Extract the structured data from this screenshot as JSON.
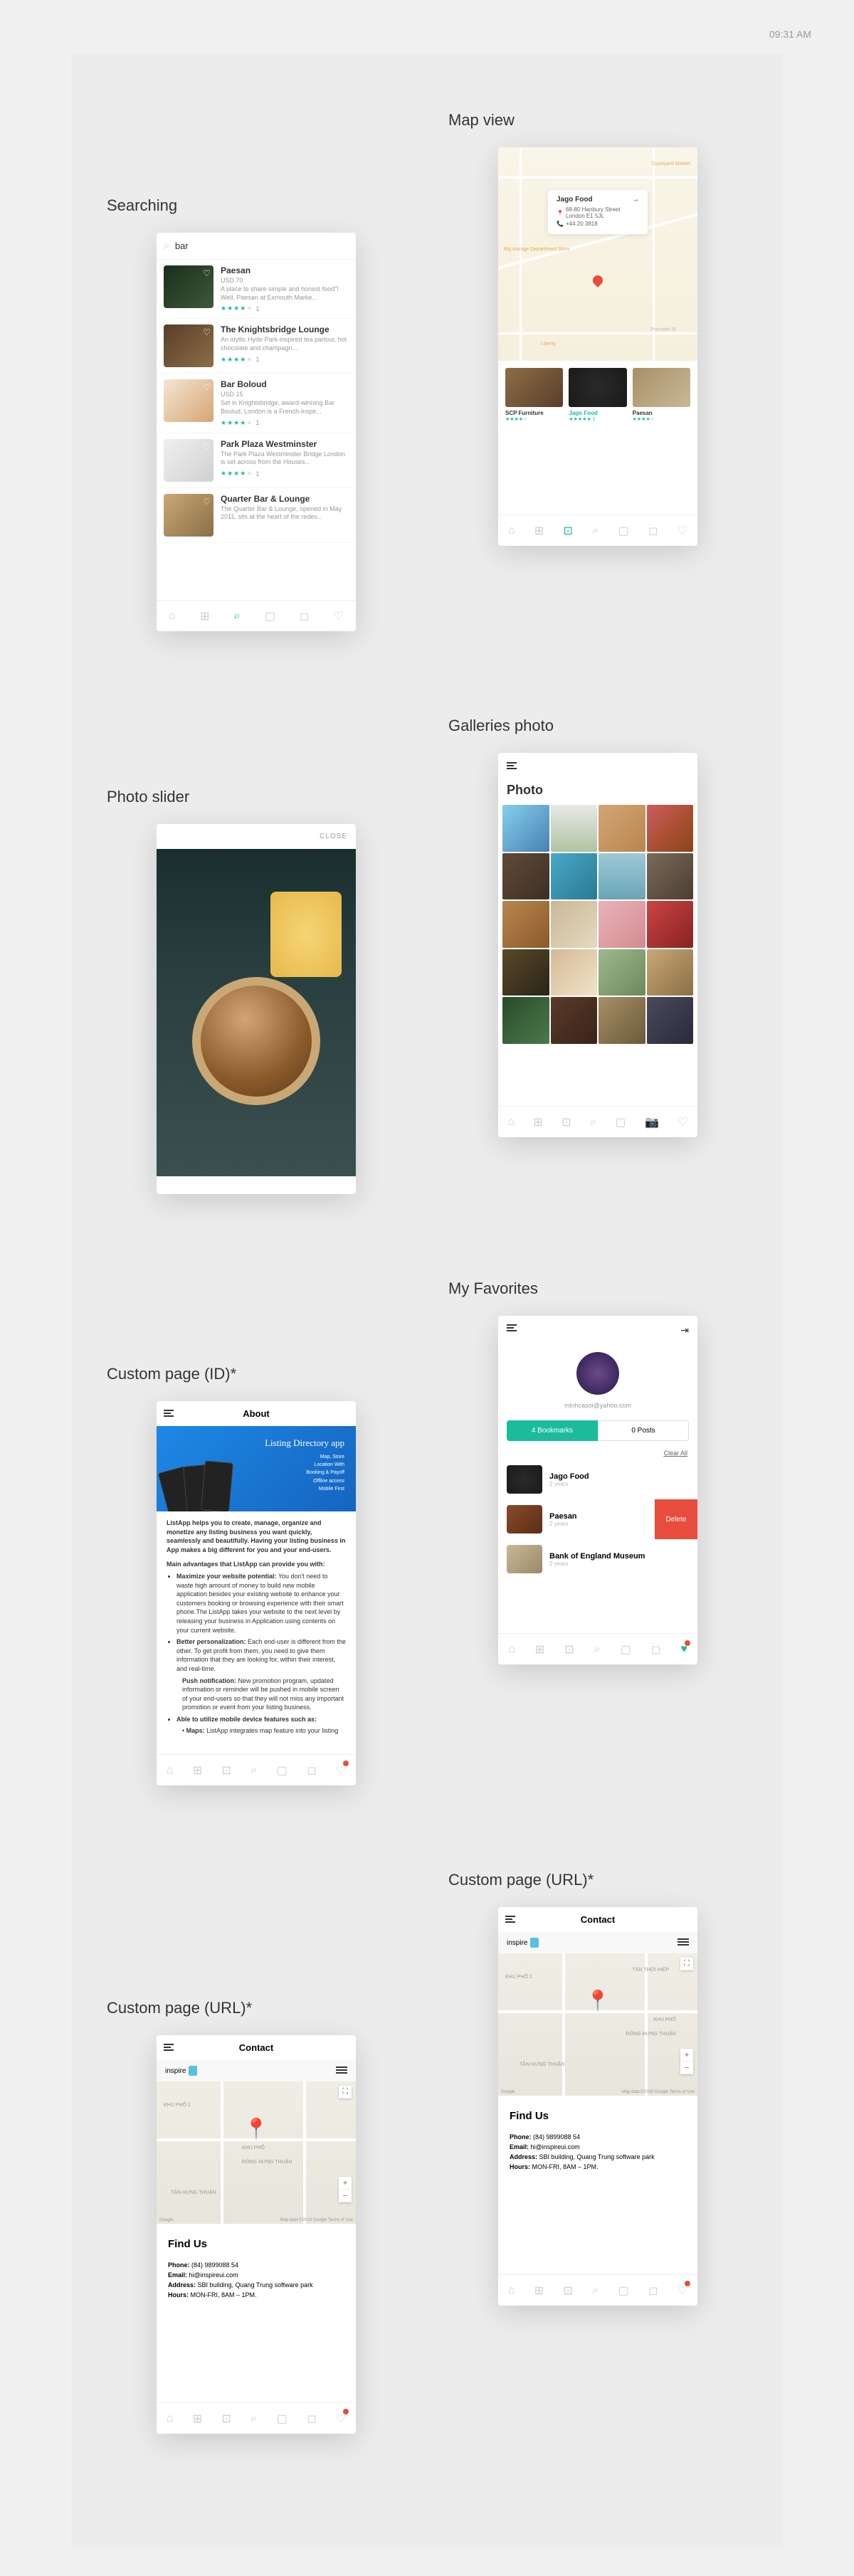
{
  "time": "09:31 AM",
  "sections": {
    "searching": "Searching",
    "mapview": "Map view",
    "galleries": "Galleries photo",
    "slider": "Photo slider",
    "favorites": "My Favorites",
    "customId": "Custom page (ID)*",
    "customUrl": "Custom page (URL)*"
  },
  "search": {
    "query": "bar",
    "results": [
      {
        "title": "Paesan",
        "price": "USD 70",
        "desc": "A place to share simple and honest food\"! Well, Paesan at Exmouth Marke...",
        "stars": 4,
        "reviews": 1
      },
      {
        "title": "The Knightsbridge Lounge",
        "price": "",
        "desc": "An idyllic Hyde Park-inspired tea parlour, hot chocolate and champagn...",
        "stars": 4,
        "reviews": 1
      },
      {
        "title": "Bar Boloud",
        "price": "USD 15",
        "desc": "Set in Knightsbridge, award-winning Bar Boulud, London is a French-inspir...",
        "stars": 4,
        "reviews": 1
      },
      {
        "title": "Park Plaza Westminster",
        "price": "",
        "desc": "The Park Plaza Westminster Bridge London is set across from the Houses...",
        "stars": 4,
        "reviews": 1
      },
      {
        "title": "Quarter Bar & Lounge",
        "price": "",
        "desc": "The Quarter Bar & Lounge, opened in May 2011, sits at the heart of the redev...",
        "stars": 0,
        "reviews": 0
      }
    ]
  },
  "map": {
    "popup": {
      "name": "Jago Food",
      "addr1": "68-80 Hanbury Street",
      "addr2": "London E1 5JL",
      "phone": "+44 20 3818"
    },
    "labels": {
      "storage": "Big storage\nDepartment Store",
      "market": "Courtyard Market",
      "liberty": "Liberty",
      "st": "Princelet St"
    },
    "cards": [
      {
        "title": "SCP Furniture"
      },
      {
        "title": "Jago Food"
      },
      {
        "title": "Paesan"
      }
    ]
  },
  "gallery": {
    "title": "Photo"
  },
  "slider": {
    "close": "CLOSE"
  },
  "favorites": {
    "email": "minhcasoi@yahoo.com",
    "tabs": {
      "bookmarks": "4 Bookmarks",
      "posts": "0 Posts"
    },
    "clear": "Clear All",
    "items": [
      {
        "title": "Jago Food",
        "sub": "2 years"
      },
      {
        "title": "Paesan",
        "sub": "2 years"
      },
      {
        "title": "Bank of England Museum",
        "sub": "2 years"
      }
    ],
    "delete": "Delete"
  },
  "about": {
    "title": "About",
    "banner": {
      "title": "Listing Directory app",
      "lines": "Map, Store\nLocation With\nBooking & Payoff\nOffline access\nMobile First"
    },
    "intro": "ListApp helps you to create, manage, organize and monetize any listing business you want quickly, seamlessly and beautifully. Having your listing business in App makes a big different for you and your end-users.",
    "advTitle": "Main advantages that ListApp can provide you with:",
    "bullets": [
      {
        "b": "Maximize your website potential:",
        "t": " You don't need to waste high amount of money to build new mobile application besides your existing website to enhance your customers booking or browsing experience with their smart phone.The ListApp takes your website to the next level by releasing your business in Application using contents on your current website."
      },
      {
        "b": "Better personalization:",
        "t": " Each end-user is different from the other. To get profit from them, you need to give them information that they are looking for, within their interest, and real-time."
      },
      {
        "b": "Push notification:",
        "t": " New promotion program, updated information or reminder will be pushed in mobile screen of your end-users so that they will not miss any important promotion or event from your listing business.",
        "indent": true
      },
      {
        "b": "Able to utilize mobile device features such as:",
        "t": ""
      },
      {
        "b": "Maps:",
        "t": " ListApp integrates map feature into your listing",
        "indent": true
      }
    ]
  },
  "contact": {
    "title": "Contact",
    "brand": "inspire",
    "areas": {
      "kp2": "KHU PHỐ 2",
      "kp": "KHU PHỐ",
      "dht": "ĐÔNG HƯNG THUẬN",
      "th": "TÂN HƯNG THUẬN",
      "thh": "TÂN THỚI HIỆP"
    },
    "mapFooter": {
      "l": "Google",
      "r": "Map data ©2018 Google    Terms of Use"
    },
    "findTitle": "Find Us",
    "phone": {
      "lbl": "Phone:",
      "val": " (84) 9899088 54"
    },
    "email": {
      "lbl": "Email:",
      "val": " hi@inspireui.com"
    },
    "address": {
      "lbl": "Address:",
      "val": " SBI building, Quang Trung software park"
    },
    "hours": {
      "lbl": "Hours:",
      "val": " MON-FRI, 8AM – 1PM."
    }
  }
}
